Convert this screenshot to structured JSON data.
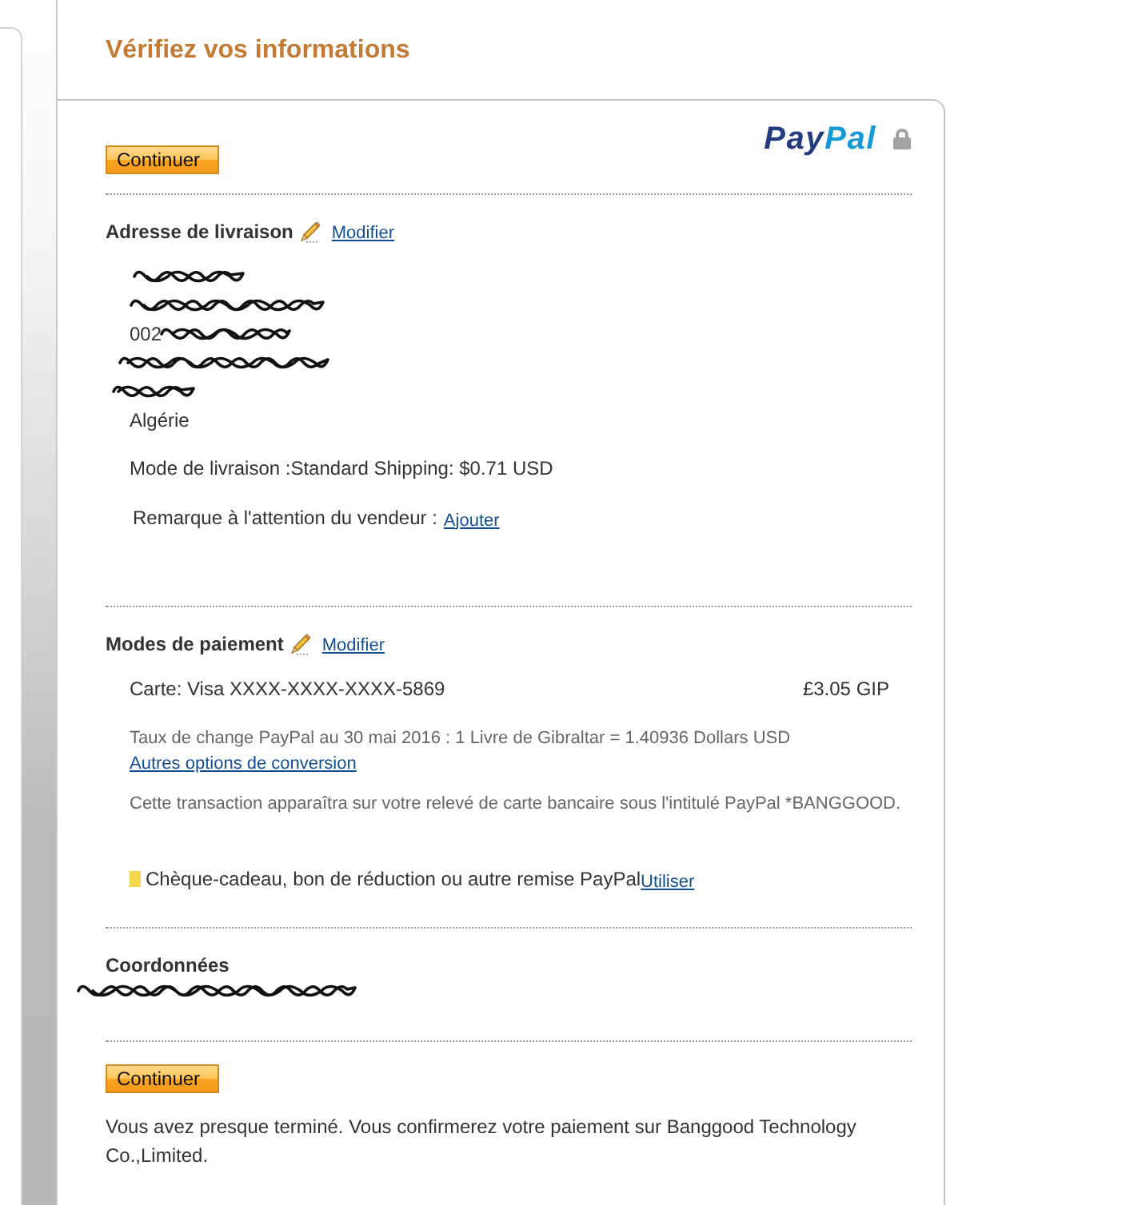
{
  "title": "Vérifiez vos informations",
  "logo": {
    "parts": [
      {
        "text": "Pay",
        "color": "#253b80"
      },
      {
        "text": "Pal",
        "color": "#179bd7"
      }
    ]
  },
  "top_button": {
    "label": "Continuer"
  },
  "shipping": {
    "heading": "Adresse de livraison",
    "edit_link": "Modifier",
    "address_lines": [
      {
        "redacted": true
      },
      {
        "redacted": true
      },
      {
        "text": "002",
        "redacted": true
      },
      {
        "redacted": true
      },
      {
        "redacted": true
      },
      {
        "text": "Algérie",
        "redacted": false
      }
    ],
    "delivery_method": "Mode de livraison :Standard Shipping: $0.71 USD",
    "seller_note": {
      "label": "Remarque à l'attention du vendeur :",
      "link": "Ajouter"
    }
  },
  "payment": {
    "heading": "Modes de paiement",
    "edit_link": "Modifier",
    "card": "Carte: Visa XXXX-XXXX-XXXX-5869",
    "amount": "£3.05 GIP",
    "exchange_rate": "Taux de change PayPal au 30 mai 2016 : 1 Livre de Gibraltar = 1.40936 Dollars USD",
    "conversion_link": "Autres options de conversion",
    "statement_note": "Cette transaction apparaîtra sur votre relevé de carte bancaire sous l'intitulé PayPal *BANGGOOD.",
    "coupon": {
      "label": "Chèque-cadeau, bon de réduction ou autre remise PayPal",
      "link": "Utiliser"
    }
  },
  "contact": {
    "heading": "Coordonnées",
    "lines": [
      {
        "redacted": true
      }
    ]
  },
  "bottom_button": {
    "label": "Continuer"
  },
  "confirmation_note": "Vous avez presque terminé. Vous confirmerez votre paiement sur Banggood Technology Co.,Limited."
}
